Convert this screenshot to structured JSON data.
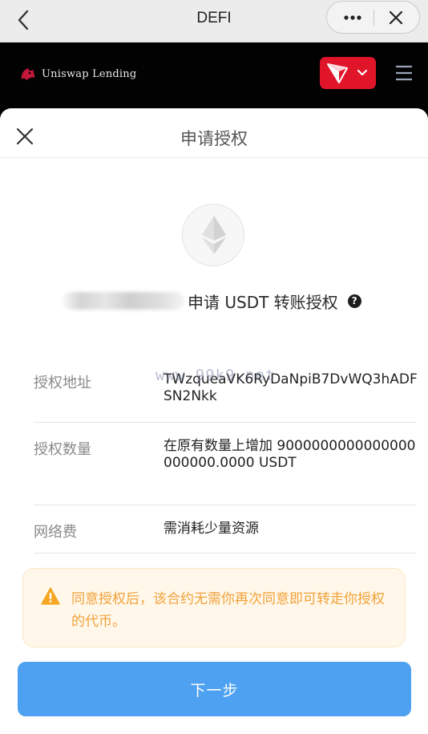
{
  "app_bar": {
    "title": "DEFI",
    "back_icon": "chevron-left-icon",
    "more_icon": "more-dots-icon",
    "close_icon": "close-icon"
  },
  "dapp_header": {
    "brand_name": "Uniswap Lending",
    "wallet_icon": "tron-logo-icon",
    "dropdown_icon": "chevron-down-icon",
    "menu_icon": "hamburger-menu-icon",
    "accent_color": "#e0152a"
  },
  "sheet": {
    "title": "申请授权",
    "close_icon": "close-icon",
    "token_icon": "ethereum-icon",
    "request_text": "申请 USDT 转账授权",
    "help_icon_glyph": "?",
    "rows": [
      {
        "label": "授权地址",
        "value": "TWzqueaVK6RyDaNpiB7DvWQ3hADFSN2Nkk"
      },
      {
        "label": "授权数量",
        "value": "在原有数量上增加 9000000000000000000000.0000 USDT"
      },
      {
        "label": "网络费",
        "value": "需消耗少量资源"
      }
    ],
    "watermark": "www.99k9.net",
    "warning_text": "同意授权后，该合约无需你再次同意即可转走你授权的代币。",
    "warning_color": "#f2a13a",
    "next_button": "下一步",
    "button_color": "#4ea1f0"
  }
}
